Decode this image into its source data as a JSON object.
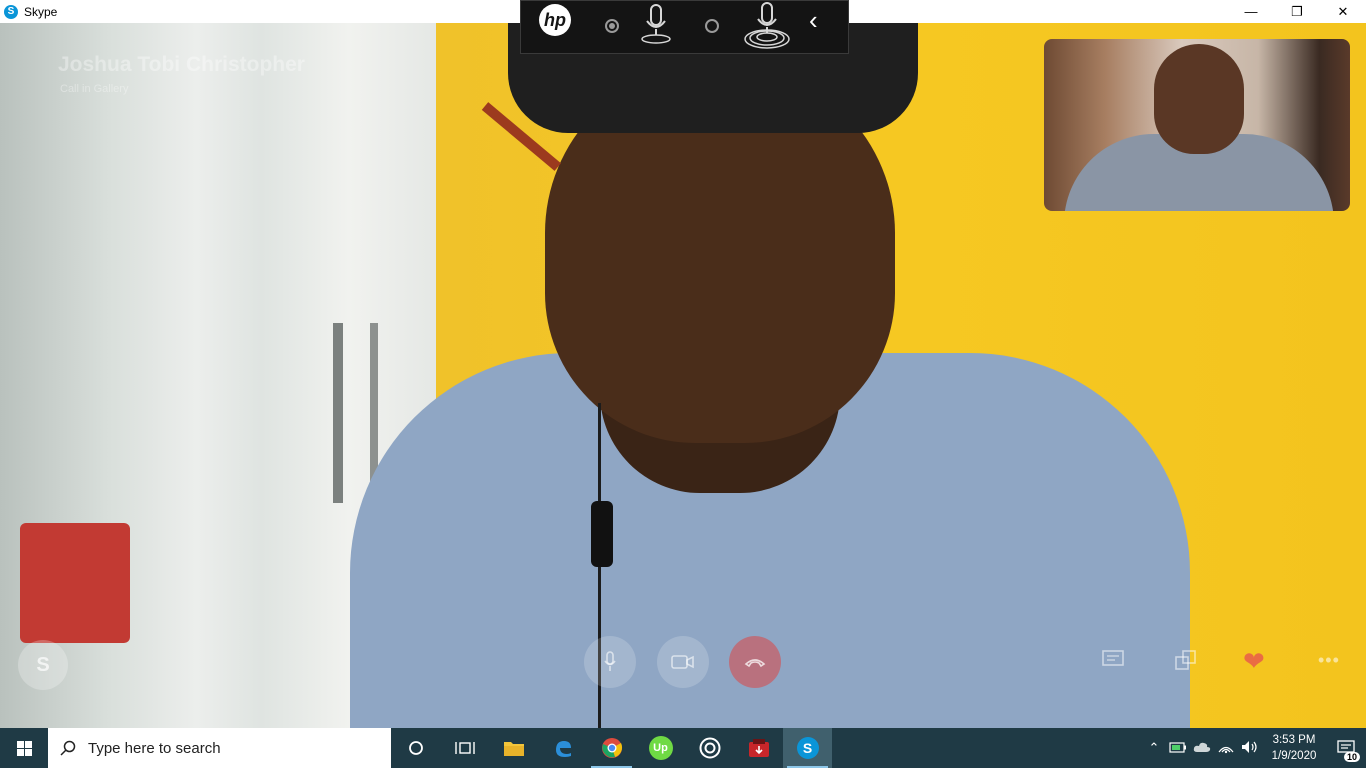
{
  "window": {
    "title": "Skype",
    "controls": [
      "minimize",
      "restore",
      "close"
    ]
  },
  "call": {
    "caller_name": "Joshua Tobi Christopher",
    "caller_status": "Call in Gallery"
  },
  "hp_toolbar": {
    "logo": "hp"
  },
  "controls": {
    "mic_icon": "microphone-icon",
    "camera_icon": "camera-icon",
    "end_icon": "end-call-icon",
    "chat_icon": "chat-icon",
    "screen_share_icon": "screen-share-icon",
    "reaction_icon": "heart-icon",
    "more_icon": "more-icon"
  },
  "taskbar": {
    "search_placeholder": "Type here to search",
    "apps": [
      "cortana",
      "task-view",
      "file-explorer",
      "edge",
      "chrome",
      "upwork",
      "obs",
      "app-red",
      "skype"
    ],
    "notification_count": "10"
  },
  "clock": {
    "time": "3:53 PM",
    "date": "1/9/2020"
  },
  "colors": {
    "skype_blue": "#0a95d8",
    "taskbar": "#1f3a45",
    "wall_yellow": "#f6c823"
  }
}
